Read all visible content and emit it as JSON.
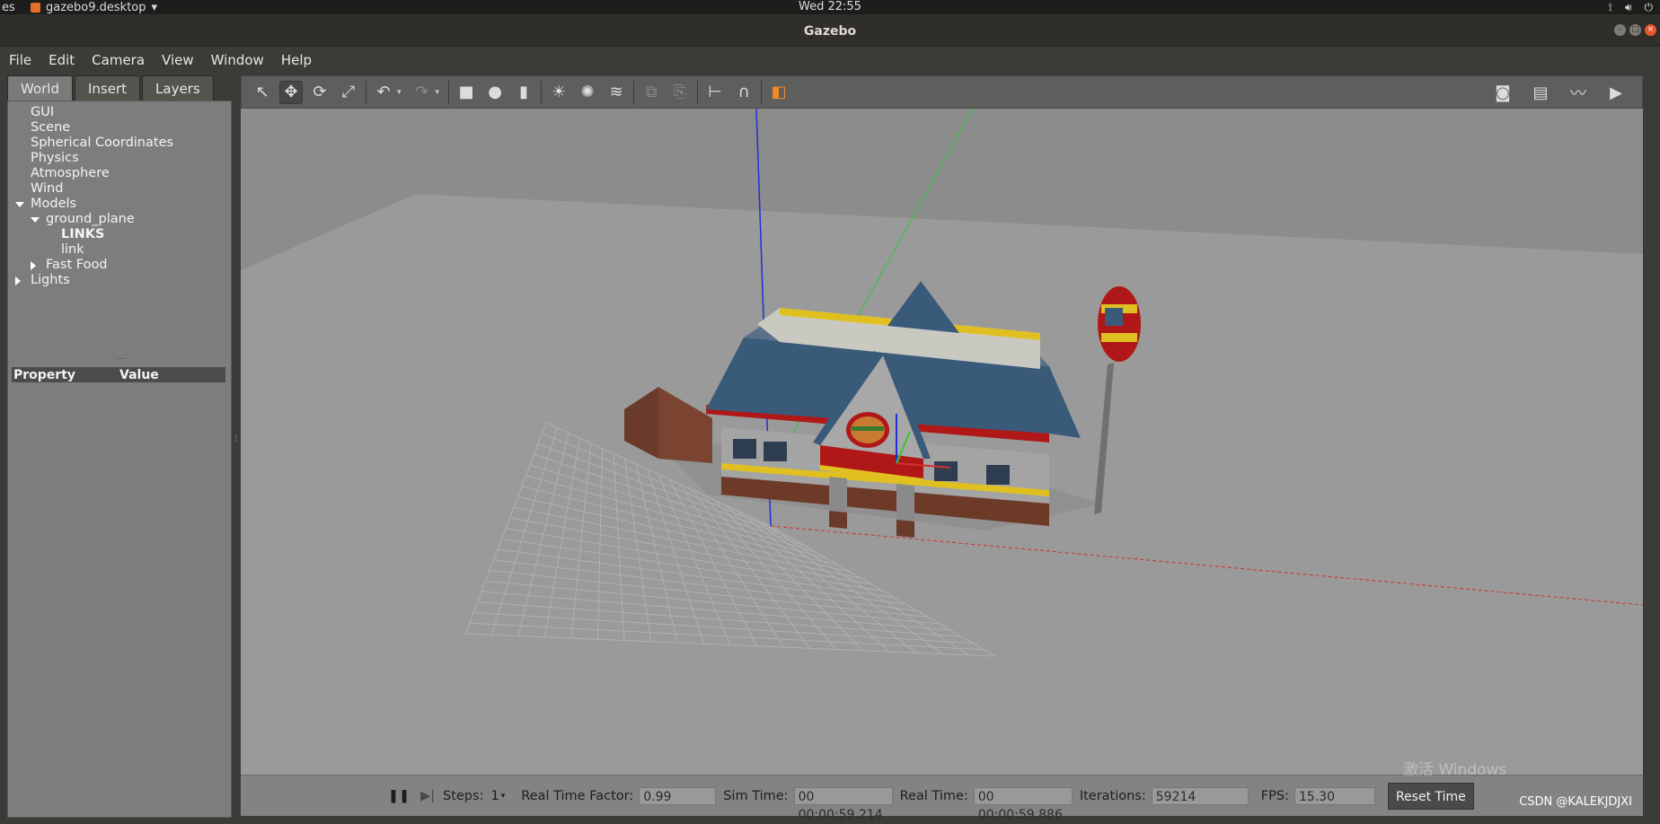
{
  "topbar": {
    "activities": "es",
    "app_name": "gazebo9.desktop",
    "app_dropdown": "▾",
    "clock": "Wed 22:55",
    "tray_icons": [
      "network-icon",
      "volume-icon",
      "power-icon"
    ]
  },
  "window": {
    "title": "Gazebo"
  },
  "menu": {
    "items": [
      "File",
      "Edit",
      "Camera",
      "View",
      "Window",
      "Help"
    ]
  },
  "left_panel": {
    "tabs": [
      "World",
      "Insert",
      "Layers"
    ],
    "active_tab": "World",
    "tree": [
      {
        "label": "GUI",
        "indent": 0,
        "arrow": "none"
      },
      {
        "label": "Scene",
        "indent": 0,
        "arrow": "none"
      },
      {
        "label": "Spherical Coordinates",
        "indent": 0,
        "arrow": "none"
      },
      {
        "label": "Physics",
        "indent": 0,
        "arrow": "none"
      },
      {
        "label": "Atmosphere",
        "indent": 0,
        "arrow": "none"
      },
      {
        "label": "Wind",
        "indent": 0,
        "arrow": "none"
      },
      {
        "label": "Models",
        "indent": 0,
        "arrow": "down"
      },
      {
        "label": "ground_plane",
        "indent": 1,
        "arrow": "down"
      },
      {
        "label": "LINKS",
        "indent": 2,
        "arrow": "none",
        "bold": true
      },
      {
        "label": "link",
        "indent": 2,
        "arrow": "none"
      },
      {
        "label": "Fast Food",
        "indent": 1,
        "arrow": "right"
      },
      {
        "label": "Lights",
        "indent": 0,
        "arrow": "right"
      }
    ],
    "splitter_dots": ".....",
    "property_header": "Property",
    "value_header": "Value"
  },
  "toolbar": {
    "tools": [
      {
        "name": "select-mode-icon",
        "glyph": "↖",
        "selected": false
      },
      {
        "name": "translate-mode-icon",
        "glyph": "✥",
        "selected": true
      },
      {
        "name": "rotate-mode-icon",
        "glyph": "⟳",
        "selected": false
      },
      {
        "name": "scale-mode-icon",
        "glyph": "⤢",
        "selected": false
      }
    ],
    "undo_glyph": "↶",
    "redo_glyph": "↷",
    "dropdown_glyph": "▾",
    "shapes": [
      {
        "name": "box-shape-icon",
        "glyph": "■"
      },
      {
        "name": "sphere-shape-icon",
        "glyph": "●"
      },
      {
        "name": "cylinder-shape-icon",
        "glyph": "▮"
      }
    ],
    "lights": [
      {
        "name": "point-light-icon",
        "glyph": "☀"
      },
      {
        "name": "spot-light-icon",
        "glyph": "✺"
      },
      {
        "name": "directional-light-icon",
        "glyph": "≋"
      }
    ],
    "edit_tools": [
      {
        "name": "copy-icon",
        "glyph": "⧉"
      },
      {
        "name": "paste-icon",
        "glyph": "⎘"
      },
      {
        "name": "align-icon",
        "glyph": "⊢"
      },
      {
        "name": "snap-icon",
        "glyph": "∩"
      },
      {
        "name": "view-angle-icon",
        "glyph": "◧"
      }
    ],
    "right_tools": [
      {
        "name": "screenshot-icon",
        "glyph": "◙"
      },
      {
        "name": "log-icon",
        "glyph": "▤"
      },
      {
        "name": "plot-icon",
        "glyph": "〰"
      },
      {
        "name": "record-video-icon",
        "glyph": "▶"
      }
    ]
  },
  "bottom_bar": {
    "pause_glyph": "❚❚",
    "step_glyph": "▶|",
    "steps_label": "Steps:",
    "steps_value": "1",
    "rtf_label": "Real Time Factor:",
    "rtf_value": "0.99",
    "sim_time_label": "Sim Time:",
    "sim_time_value": "00 00:00:59.214",
    "real_time_label": "Real Time:",
    "real_time_value": "00 00:00:59.886",
    "iterations_label": "Iterations:",
    "iterations_value": "59214",
    "fps_label": "FPS:",
    "fps_value": "15.30",
    "reset_label": "Reset Time"
  },
  "overlays": {
    "watermark": "CSDN @KALEKJDJXI",
    "activate_windows": "激活 Windows"
  },
  "colors": {
    "x_axis": "#d43030",
    "y_axis": "#30c830",
    "z_axis": "#2030d8",
    "roof": "#3a5a7a",
    "brick": "#6a3a2a",
    "trim_yellow": "#e0c020",
    "trim_red": "#b01818"
  }
}
